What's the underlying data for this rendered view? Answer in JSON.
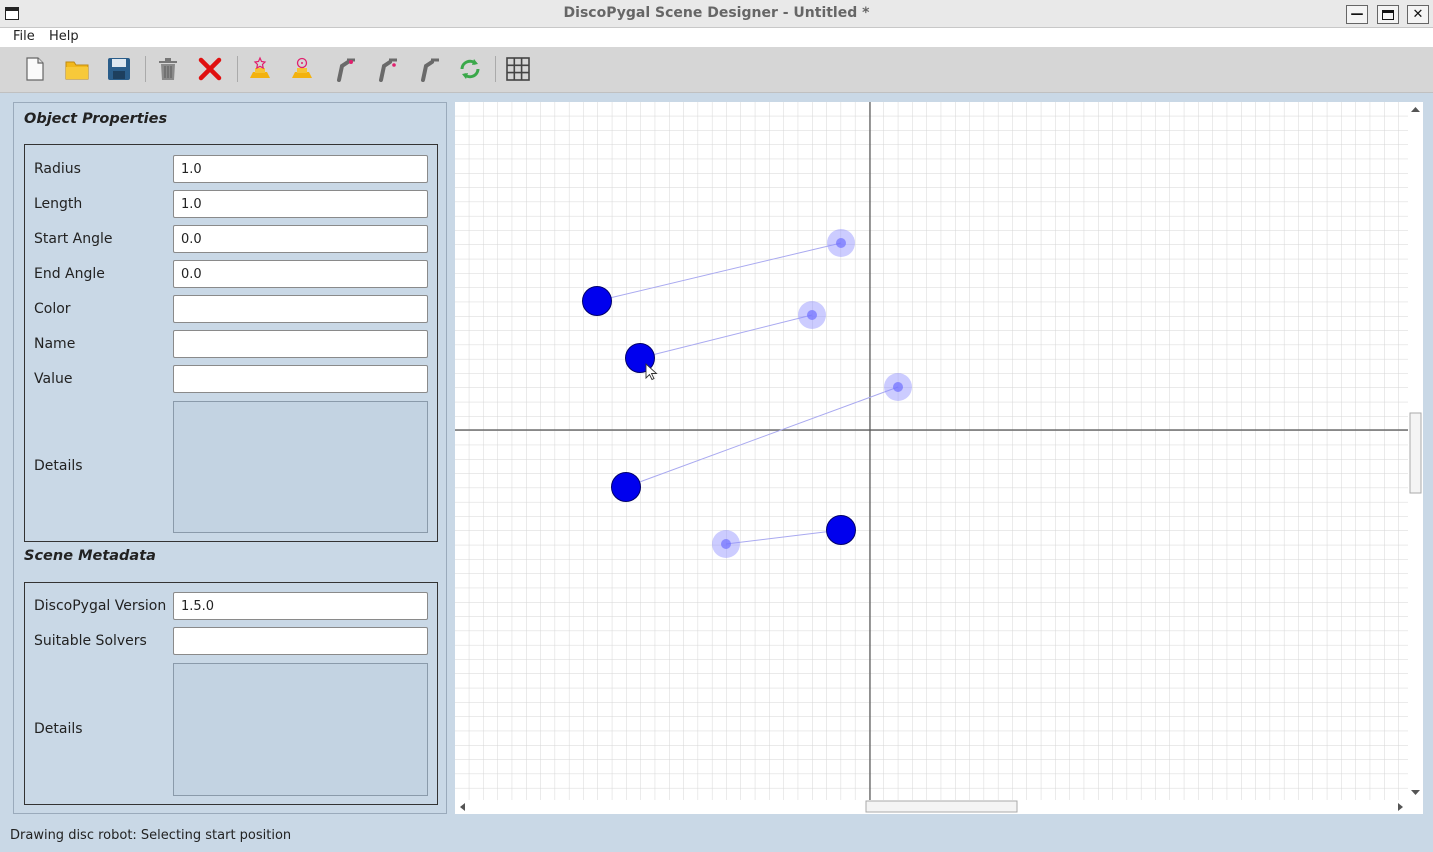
{
  "window": {
    "title": "DiscoPygal Scene Designer - Untitled *"
  },
  "menu": {
    "file": "File",
    "help": "Help"
  },
  "toolbar": {
    "icons": [
      "new-file-icon",
      "open-folder-icon",
      "save-icon",
      "delete-icon",
      "clear-all-icon",
      "add-robot-icon",
      "add-disc-icon",
      "robot-arm-icon",
      "robot-arm-2-icon",
      "robot-arm-3-icon",
      "refresh-icon",
      "grid-icon"
    ]
  },
  "object_properties": {
    "title": "Object Properties",
    "fields": [
      {
        "label": "Radius",
        "value": "1.0"
      },
      {
        "label": "Length",
        "value": "1.0"
      },
      {
        "label": "Start Angle",
        "value": "0.0"
      },
      {
        "label": "End Angle",
        "value": "0.0"
      },
      {
        "label": "Color",
        "value": ""
      },
      {
        "label": "Name",
        "value": ""
      },
      {
        "label": "Value",
        "value": ""
      }
    ],
    "details_label": "Details"
  },
  "scene_metadata": {
    "title": "Scene Metadata",
    "fields": [
      {
        "label": "DiscoPygal Version",
        "value": "1.5.0"
      },
      {
        "label": "Suitable Solvers",
        "value": ""
      }
    ],
    "details_label": "Details"
  },
  "scene": {
    "robot_color": "#0000ee",
    "target_color": "#8f8fff"
  },
  "status": {
    "text": "Drawing disc robot: Selecting start position"
  }
}
